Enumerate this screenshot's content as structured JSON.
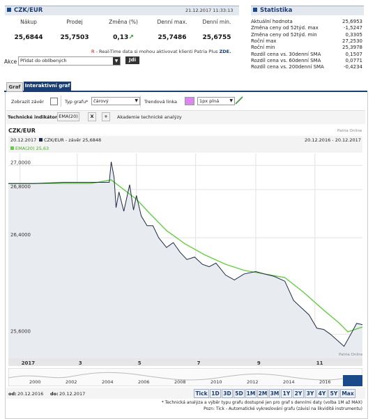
{
  "quote": {
    "title": "CZK/EUR",
    "datetime": "21.12.2017 11:33:13",
    "headers": [
      "Nákup",
      "Prodej",
      "Změna (%)",
      "Denní max.",
      "Denní min."
    ],
    "values": [
      "25,6844",
      "25,7503",
      "0,13",
      "25,7486",
      "25,6755"
    ],
    "change_arrow": "↗",
    "realtime_note_r": "R",
    "realtime_note": " - Real-Time data si mohou aktivovat klienti Patria Plus ",
    "realtime_link": "ZDE.",
    "akce_label": "Akce",
    "akce_value": "Přidat do oblíbených",
    "go_button": "Jdi"
  },
  "stats": {
    "title": "Statistika",
    "rows": [
      {
        "label": "Aktuální hodnota",
        "value": "25,6953"
      },
      {
        "label": "Změna ceny od 52týd. max",
        "value": "-1,5247"
      },
      {
        "label": "Změna ceny od 52týd. min",
        "value": "0,3305"
      },
      {
        "label": "Roční max",
        "value": "27,2530"
      },
      {
        "label": "Roční min",
        "value": "25,3978"
      },
      {
        "label": "Rozdíl cena vs. 30denní SMA",
        "value": "0,1507"
      },
      {
        "label": "Rozdíl cena vs. 60denní SMA",
        "value": "0,0771"
      },
      {
        "label": "Rozdíl cena vs. 200denní SMA",
        "value": "-0,4234"
      }
    ]
  },
  "tabs": [
    "Graf",
    "Interaktivní graf"
  ],
  "controls": {
    "show_close_label": "Zobrazit závěr",
    "chart_type_label": "Typ grafu*",
    "chart_type_value": "čárový",
    "trend_label": "Trendová linka",
    "trend_width_value": "1px plná",
    "tech_label": "Technické indikátory*:",
    "indicator": "EMA(20)",
    "remove": "X",
    "add": "+",
    "academy": "Akademie technické analýzy"
  },
  "colors": {
    "accent": "#1a3d74",
    "ema": "#66cc44",
    "price": "#1f2a44",
    "trend_swatch": "#dd88ee",
    "chart_bg": "#e8ebf0"
  },
  "chart_data": {
    "type": "line",
    "title": "CZK/EUR",
    "source": "Patria Online",
    "legend_date": "20.12.2017",
    "legend_series": "CZK/EUR - závěr 25,6848",
    "legend_ema": "EMA(20) 25,63",
    "range_label": "20.12.2016 - 20.12.2017",
    "xlim": [
      "2016-12-20",
      "2017-12-20"
    ],
    "ylim": [
      25.4,
      27.1
    ],
    "y_ticks": [
      "27,0000",
      "26,8000",
      "26,4000",
      "25,6000"
    ],
    "y_tick_values": [
      27.0,
      26.8,
      26.4,
      25.6
    ],
    "x_ticks": [
      "2017",
      "3",
      "5",
      "7",
      "9",
      "11"
    ],
    "x_tick_dates": [
      "2017-01-01",
      "2017-03-01",
      "2017-05-01",
      "2017-07-01",
      "2017-09-01",
      "2017-11-01"
    ],
    "grid": true,
    "series": [
      {
        "name": "CZK/EUR - závěr 25,6848",
        "x": [
          "2016-12-20",
          "2017-01-15",
          "2017-02-15",
          "2017-03-15",
          "2017-04-03",
          "2017-04-05",
          "2017-04-08",
          "2017-04-10",
          "2017-04-13",
          "2017-04-18",
          "2017-04-24",
          "2017-04-28",
          "2017-05-01",
          "2017-05-06",
          "2017-05-12",
          "2017-05-18",
          "2017-05-24",
          "2017-06-01",
          "2017-06-08",
          "2017-06-15",
          "2017-06-22",
          "2017-06-30",
          "2017-07-08",
          "2017-07-15",
          "2017-07-22",
          "2017-08-01",
          "2017-08-10",
          "2017-08-20",
          "2017-09-01",
          "2017-09-10",
          "2017-09-20",
          "2017-10-01",
          "2017-10-10",
          "2017-10-18",
          "2017-10-26",
          "2017-11-03",
          "2017-11-10",
          "2017-11-17",
          "2017-11-24",
          "2017-12-01",
          "2017-12-08",
          "2017-12-14",
          "2017-12-20"
        ],
        "values": [
          26.85,
          26.85,
          26.86,
          26.86,
          26.86,
          27.03,
          26.9,
          26.65,
          26.78,
          26.62,
          26.84,
          26.63,
          26.75,
          26.58,
          26.5,
          26.5,
          26.4,
          26.32,
          26.36,
          26.28,
          26.22,
          26.24,
          26.18,
          26.16,
          26.19,
          26.09,
          26.05,
          26.1,
          26.12,
          26.1,
          26.08,
          26.04,
          25.88,
          25.82,
          25.76,
          25.65,
          25.64,
          25.6,
          25.55,
          25.5,
          25.6,
          25.69,
          25.68
        ]
      },
      {
        "name": "EMA(20) 25,63",
        "x": [
          "2016-12-20",
          "2017-03-15",
          "2017-04-05",
          "2017-04-18",
          "2017-05-01",
          "2017-05-15",
          "2017-06-01",
          "2017-06-20",
          "2017-07-10",
          "2017-08-01",
          "2017-08-20",
          "2017-09-10",
          "2017-10-01",
          "2017-10-20",
          "2017-11-10",
          "2017-11-25",
          "2017-12-05",
          "2017-12-20"
        ],
        "values": [
          26.85,
          26.85,
          26.88,
          26.8,
          26.72,
          26.6,
          26.46,
          26.35,
          26.26,
          26.18,
          26.13,
          26.1,
          26.07,
          25.95,
          25.8,
          25.7,
          25.62,
          25.66
        ]
      }
    ]
  },
  "navigator": {
    "years": [
      "2000",
      "2002",
      "2004",
      "2006",
      "2008",
      "2010",
      "2012",
      "2014",
      "2016"
    ]
  },
  "bottom": {
    "from_label": "od:",
    "from_value": "20.12.2016",
    "to_label": "do:",
    "to_value": "20.12.2017",
    "ranges": [
      "Tick",
      "1D",
      "3D",
      "5D",
      "1M",
      "2M",
      "3M",
      "1Y",
      "2Y",
      "3Y",
      "4Y",
      "5Y",
      "Max"
    ],
    "note1": "* Technická analýza a výběr typu grafu dostupné jen pro graf s denními daty (volba 1M až MAX)",
    "note2": "Pozn: Tick - Automatické vykreslování grafu (závisí na likviditě instrumentu)"
  }
}
